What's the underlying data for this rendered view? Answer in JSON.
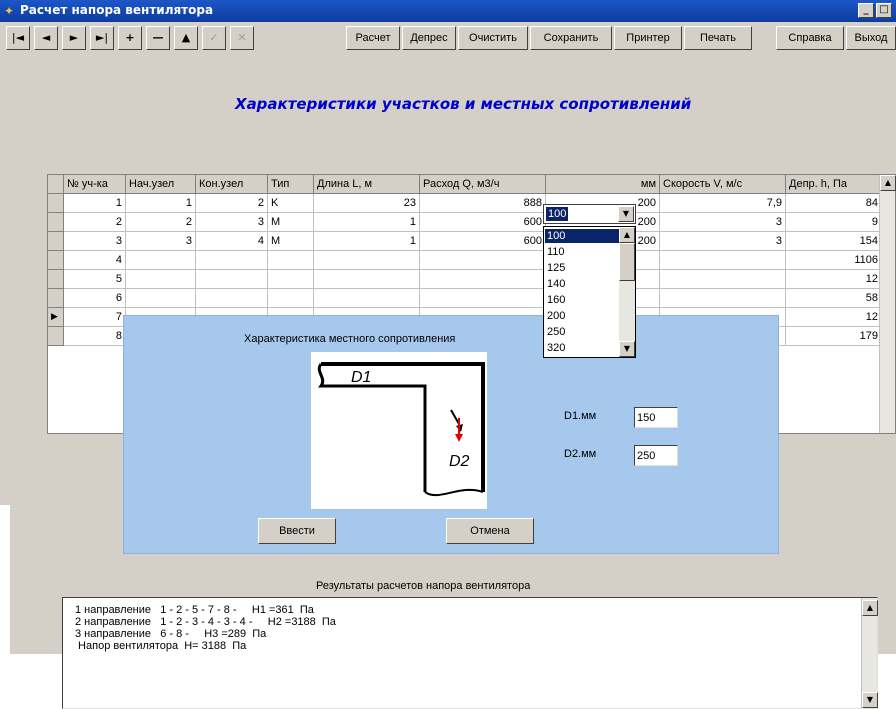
{
  "window": {
    "title": "Расчет напора вентилятора",
    "controls": [
      "_",
      "□"
    ]
  },
  "toolbar": {
    "nav_buttons": [
      "|◄",
      "◄",
      "►",
      "►|",
      "+",
      "—",
      "▲",
      "✓",
      "✕"
    ],
    "text_buttons": [
      "Расчет",
      "Депрес",
      "Очистить",
      "Сохранить",
      "Принтер",
      "Печать",
      "Справка",
      "Выход"
    ]
  },
  "heading": "Характеристики  участков и местных сопротивлений",
  "grid": {
    "columns": [
      "№ уч-ка",
      "Нач.узел",
      "Кон.узел",
      "Тип",
      "Длина L, м",
      "Расход Q, м3/ч",
      "мм",
      "Скорость V, м/с",
      "Депр. h, Па"
    ],
    "rows": [
      [
        "1",
        "1",
        "2",
        "K",
        "23",
        "888",
        "200",
        "7,9",
        "84"
      ],
      [
        "2",
        "2",
        "3",
        "M",
        "1",
        "600",
        "200",
        "3",
        "9"
      ],
      [
        "3",
        "3",
        "4",
        "M",
        "1",
        "600",
        "200",
        "3",
        "154"
      ],
      [
        "4",
        "",
        "",
        "",
        "",
        "",
        "",
        "",
        "1106"
      ],
      [
        "5",
        "",
        "",
        "",
        "",
        "",
        "",
        "",
        "12"
      ],
      [
        "6",
        "",
        "",
        "",
        "",
        "",
        "",
        "",
        "58"
      ],
      [
        "7",
        "",
        "",
        "",
        "",
        "",
        "",
        "",
        "12"
      ],
      [
        "8",
        "",
        "",
        "",
        "",
        "",
        "",
        "",
        "179"
      ]
    ],
    "current_row_marker": "▶"
  },
  "combo": {
    "value": "100",
    "options": [
      "100",
      "110",
      "125",
      "140",
      "160",
      "200",
      "250",
      "320"
    ],
    "selected_index": 0
  },
  "dialog": {
    "title": "Характеристика  местного сопротивления",
    "diagram": {
      "d1_label": "D1",
      "d2_label": "D2"
    },
    "d1_label": "D1.мм",
    "d1_value": "150",
    "d2_label": "D2.мм",
    "d2_value": "250",
    "ok_label": "Ввести",
    "cancel_label": "Отмена"
  },
  "results": {
    "title": "Результаты расчетов напора вентилятора",
    "lines": [
      "1 направление   1 - 2 - 5 - 7 - 8 -     H1 =361  Па",
      "2 направление   1 - 2 - 3 - 4 - 3 - 4 -     H2 =3188  Па",
      "3 направление   6 - 8 -     H3 =289  Па",
      " Напор вентилятора  H= 3188  Па"
    ]
  },
  "colors": {
    "titlebar": "#0d3c9e",
    "heading": "#0000cc",
    "dialog_bg": "#a6c8ec",
    "selection": "#0a246a",
    "diagram_arrow": "#e00000"
  }
}
